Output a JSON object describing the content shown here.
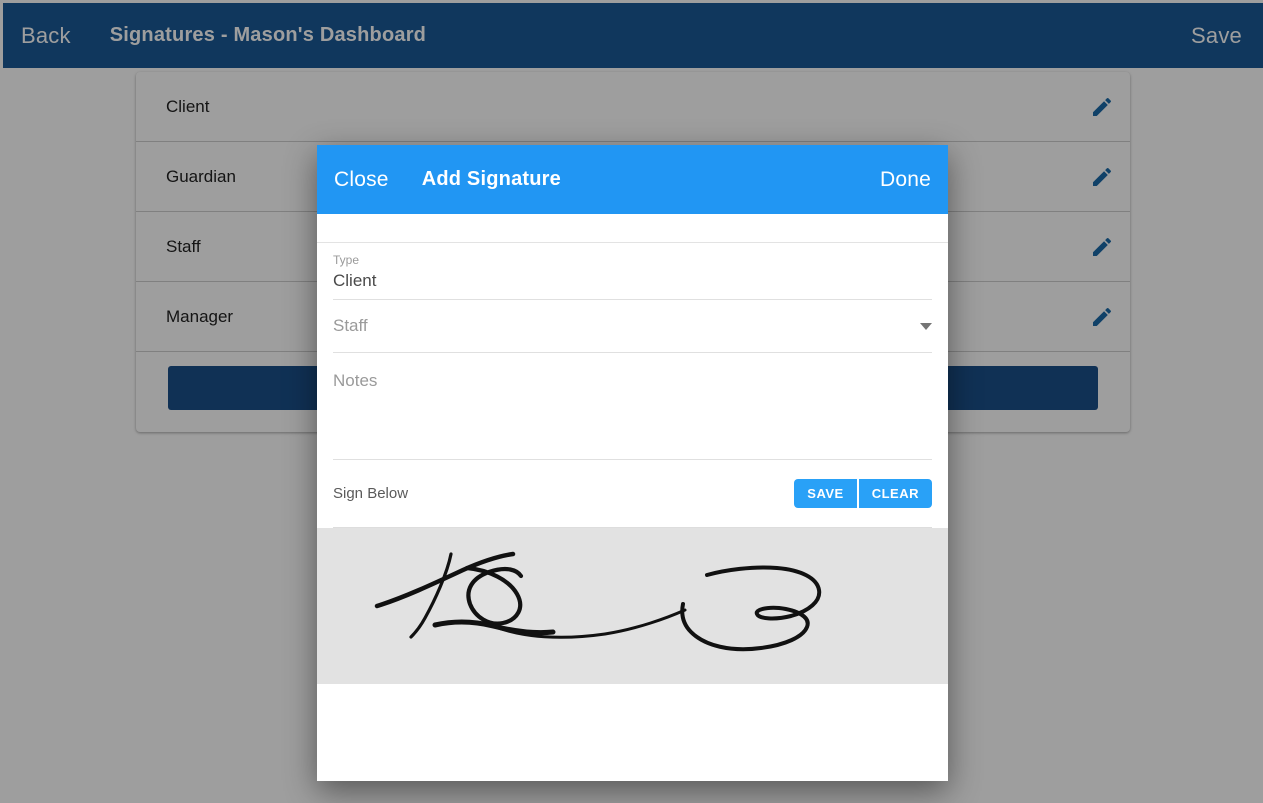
{
  "app": {
    "topbar": {
      "back_label": "Back",
      "title": "Signatures - Mason's Dashboard",
      "save_label": "Save",
      "background_color": "#1a5a96"
    }
  },
  "signature_list": {
    "rows": [
      {
        "label": "Client",
        "edit_icon": "pencil-icon"
      },
      {
        "label": "Guardian",
        "edit_icon": "pencil-icon"
      },
      {
        "label": "Staff",
        "edit_icon": "pencil-icon"
      },
      {
        "label": "Manager",
        "edit_icon": "pencil-icon"
      }
    ],
    "action_button_label": "",
    "action_button_color": "#1b4f8a",
    "edit_icon_color": "#1a6aa8"
  },
  "modal": {
    "header": {
      "close_label": "Close",
      "title": "Add Signature",
      "done_label": "Done",
      "background_color": "#2196f3"
    },
    "fields": {
      "type": {
        "label": "Type",
        "value": "Client"
      },
      "staff": {
        "placeholder": "Staff",
        "value": "",
        "arrow_icon": "chevron-down-icon"
      },
      "notes": {
        "placeholder": "Notes",
        "value": ""
      }
    },
    "sign_section": {
      "label": "Sign Below",
      "save_label": "SAVE",
      "clear_label": "CLEAR",
      "button_color": "#29a1f7",
      "pad_background": "#e2e2e2",
      "ink_color": "#111111"
    }
  }
}
